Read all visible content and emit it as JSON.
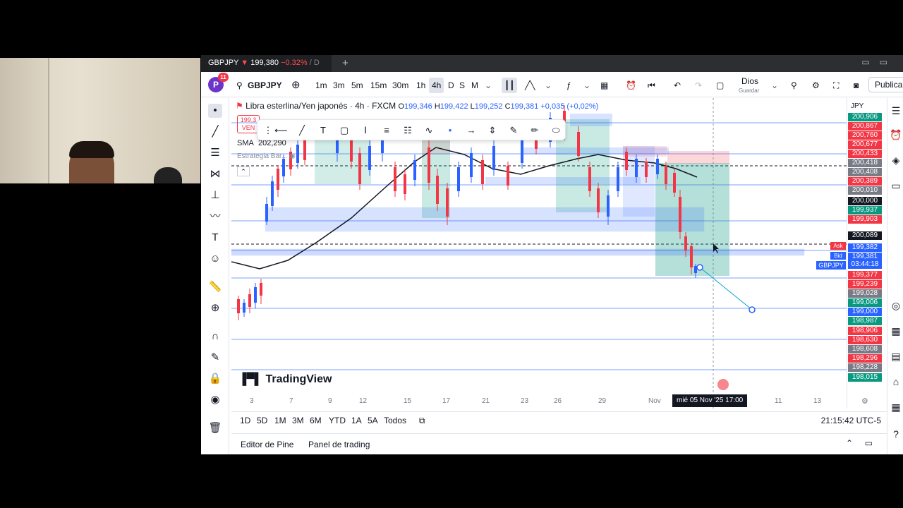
{
  "tab": {
    "symbol": "GBPJPY",
    "price": "199,380",
    "change": "−0.32%",
    "more": "/ D"
  },
  "toolbar": {
    "avatar_letter": "P",
    "notifications": "11",
    "symbol": "GBPJPY",
    "intervals": [
      "1m",
      "3m",
      "5m",
      "15m",
      "30m",
      "1h",
      "4h",
      "D",
      "S",
      "M"
    ],
    "active_interval": "4h",
    "layout_name": "Dios",
    "layout_sub": "Guardar",
    "publish": "Publicar"
  },
  "legend": {
    "title": "Libra esterlina/Yen japonés · 4h · FXCM",
    "o_label": "O",
    "o": "199,346",
    "h_label": "H",
    "h": "199,422",
    "l_label": "L",
    "l": "199,252",
    "c_label": "C",
    "c": "199,381",
    "change": "+0,035 (+0,02%)",
    "sell_price": "199,3",
    "sell_label": "VEN",
    "sma_label": "SMA",
    "sma_value": "202,290",
    "strategy": "Estrategia Bar..."
  },
  "watermark": "TradingView",
  "price_scale": {
    "currency": "JPY",
    "labels": [
      {
        "text": "200,906",
        "color": "#089981"
      },
      {
        "text": "200,867",
        "color": "#f23645"
      },
      {
        "text": "200,760",
        "color": "#f23645"
      },
      {
        "text": "200,677",
        "color": "#f23645"
      },
      {
        "text": "200,433",
        "color": "#f23645"
      },
      {
        "text": "200,418",
        "color": "#787b86"
      },
      {
        "text": "200,408",
        "color": "#787b86"
      },
      {
        "text": "200,389",
        "color": "#f23645"
      },
      {
        "text": "200,010",
        "color": "#787b86"
      },
      {
        "text": "200,000",
        "color": "#131722"
      },
      {
        "text": "199,937",
        "color": "#089981"
      },
      {
        "text": "199,903",
        "color": "#f23645"
      },
      {
        "text": "200,089",
        "color": "#131722"
      },
      {
        "text": "199,382",
        "color": "#2962ff"
      },
      {
        "text": "199,381",
        "color": "#2962ff"
      },
      {
        "text": "03:44:18",
        "color": "#2962ff"
      },
      {
        "text": "199,377",
        "color": "#f23645"
      },
      {
        "text": "199,239",
        "color": "#f23645"
      },
      {
        "text": "199,028",
        "color": "#787b86"
      },
      {
        "text": "199,006",
        "color": "#089981"
      },
      {
        "text": "199,000",
        "color": "#2962ff"
      },
      {
        "text": "198,987",
        "color": "#089981"
      },
      {
        "text": "198,906",
        "color": "#f23645"
      },
      {
        "text": "198,630",
        "color": "#f23645"
      },
      {
        "text": "198,608",
        "color": "#787b86"
      },
      {
        "text": "198,296",
        "color": "#f23645"
      },
      {
        "text": "198,228",
        "color": "#787b86"
      },
      {
        "text": "198,015",
        "color": "#089981"
      }
    ],
    "ask": "Ask",
    "bid": "Bid",
    "symbol_tag": "GBPJPY"
  },
  "time_scale": {
    "labels": [
      "3",
      "7",
      "9",
      "12",
      "15",
      "17",
      "21",
      "23",
      "26",
      "29",
      "Nov",
      "11",
      "13"
    ],
    "crosshair": "mié 05 Nov '25   17:00"
  },
  "range_bar": {
    "ranges": [
      "1D",
      "5D",
      "1M",
      "3M",
      "6M",
      "YTD",
      "1A",
      "5A",
      "Todos"
    ],
    "clock": "21:15:42 UTC-5"
  },
  "bottom_panel": {
    "pine": "Editor de Pine",
    "trading": "Panel de trading"
  },
  "colors": {
    "up": "#2962ff",
    "down": "#f23645",
    "accent": "#2962ff"
  }
}
